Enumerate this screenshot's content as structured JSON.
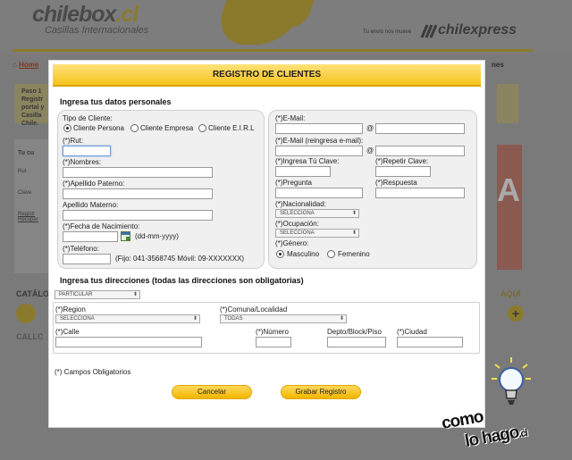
{
  "background": {
    "logo_main": "chilebox",
    "logo_suffix": ".cl",
    "tagline": "Casillas Internacionales",
    "courier_tagline": "Tu envío nos mueve",
    "courier_logo": "chilexpress",
    "nav_home": "Home",
    "nav_right": "nes",
    "paso_text": "Paso 1\nRegistr\nportal y\nCasilla\nChile.",
    "login_fields": [
      "Tu cu",
      "Rut",
      "Clave",
      "Registr",
      "Recuper"
    ],
    "catalog_label": "CATÁLO",
    "aqui_label": "AQUÍ",
    "callcenter_label": "CALLC",
    "promo_letter": "A"
  },
  "modal": {
    "title": "REGISTRO DE CLIENTES",
    "personal_section_title": "Ingresa tus datos personales",
    "tipo_cliente_label": "Tipo de Cliente:",
    "tipo_options": [
      "Cliente Persona",
      "Cliente Empresa",
      "Cliente E.I.R.L"
    ],
    "tipo_selected": "Cliente Persona",
    "rut_label": "(*)Rut:",
    "nombres_label": "(*)Nombres:",
    "apellido_paterno_label": "(*)Apellido Paterno:",
    "apellido_materno_label": "Apellido Materno:",
    "fecha_label": "(*)Fecha de Nacimiento:",
    "fecha_hint": "(dd-mm-yyyy)",
    "telefono_label": "(*)Teléfono:",
    "telefono_hint": "(Fijo: 041-3568745  Móvil: 09-XXXXXXX)",
    "email_label": "(*)E-Mail:",
    "email_confirm_label": "(*)E-Mail (reingresa e-mail):",
    "at_symbol": "@",
    "clave_label": "(*)Ingresa Tú Clave:",
    "repetir_clave_label": "(*)Repetir Clave:",
    "pregunta_label": "(*)Pregunta",
    "respuesta_label": "(*)Respuesta",
    "nacionalidad_label": "(*)Nacionalidad:",
    "nacionalidad_value": "SELECCIONA",
    "ocupacion_label": "(*)Ocupación:",
    "ocupacion_value": "SELECCIONA",
    "genero_label": "(*)Género:",
    "genero_options": [
      "Masculino",
      "Femenino"
    ],
    "genero_selected": "Masculino",
    "address_section_title": "Ingresa tus direcciones (todas las direcciones son obligatorias)",
    "address_type_value": "PARTICULAR",
    "region_label": "(*)Region",
    "region_value": "SELECCIONA",
    "comuna_label": "(*)Comuna/Localidad",
    "comuna_value": "TODAS",
    "calle_label": "(*)Calle",
    "numero_label": "(*)Número",
    "depto_label": "Depto/Block/Piso",
    "ciudad_label": "(*)Ciudad",
    "required_note": "(*) Campos Obligatorios",
    "cancel_label": "Cancelar",
    "submit_label": "Grabar Registro"
  },
  "watermark": {
    "line1": "como",
    "line2": "lo hago",
    "suffix": ".cl"
  }
}
